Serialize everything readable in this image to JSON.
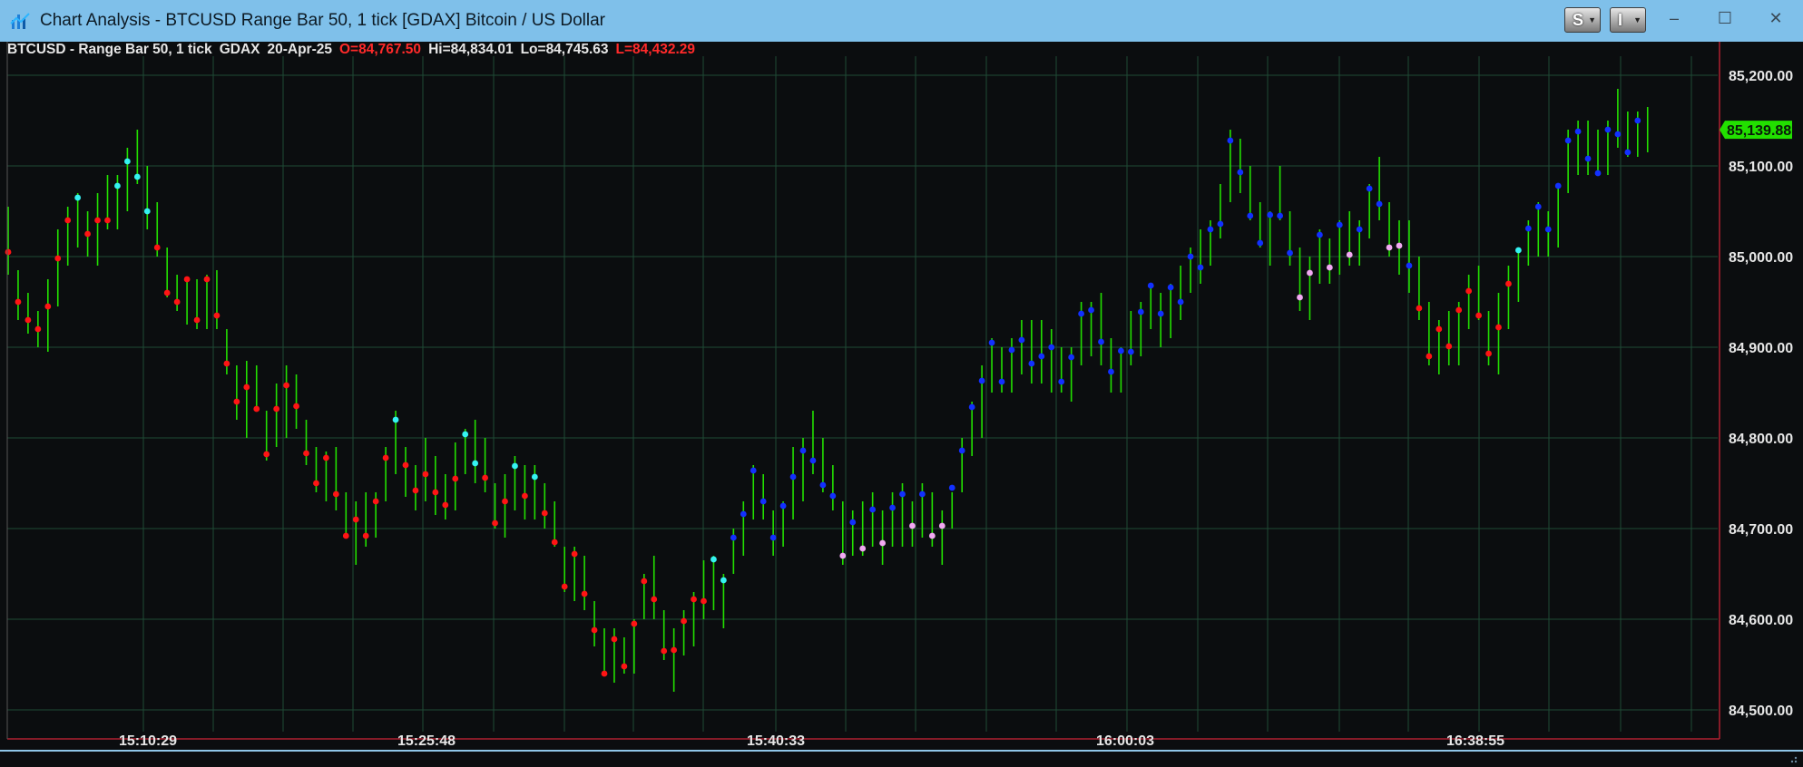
{
  "window": {
    "title": "Chart Analysis - BTCUSD Range Bar 50, 1 tick [GDAX] Bitcoin / US Dollar",
    "buttons": [
      {
        "label": "S"
      },
      {
        "label": "I"
      }
    ],
    "controls": {
      "minimize": "–",
      "maximize": "☐",
      "close": "✕"
    }
  },
  "header": {
    "symbol": "BTCUSD - Range Bar 50, 1 tick",
    "exchange": "GDAX",
    "date": "20-Apr-25",
    "open": "O=84,767.50",
    "high": "Hi=84,834.01",
    "low": "Lo=84,745.63",
    "last": "L=84,432.29"
  },
  "colors": {
    "background": "#0b0d0f",
    "grid": "#1f4a36",
    "bar": "#22e000",
    "axis_separator": "#b02030",
    "last_price_badge": "#22e000",
    "dot_red": "#ff1414",
    "dot_cyan": "#35f2f2",
    "dot_blue": "#1230ff",
    "dot_pink": "#f2a8f2"
  },
  "chart_data": {
    "type": "range-bar",
    "ylim": [
      84480,
      85240
    ],
    "y_ticks": [
      "85,200.00",
      "85,100.00",
      "85,000.00",
      "84,900.00",
      "84,800.00",
      "84,700.00",
      "84,600.00",
      "84,500.00"
    ],
    "x_ticks": [
      "15:10:29",
      "15:25:48",
      "15:40:33",
      "16:00:03",
      "16:38:55"
    ],
    "last_price": "85,139.88",
    "bars": [
      {
        "h": 85055,
        "l": 84980,
        "c": 85005,
        "dot": "red"
      },
      {
        "h": 84985,
        "l": 84930,
        "c": 84950,
        "dot": "red"
      },
      {
        "h": 84960,
        "l": 84915,
        "c": 84930,
        "dot": "red"
      },
      {
        "h": 84940,
        "l": 84900,
        "c": 84920,
        "dot": "red"
      },
      {
        "h": 84975,
        "l": 84895,
        "c": 84945,
        "dot": "red"
      },
      {
        "h": 85030,
        "l": 84945,
        "c": 84998,
        "dot": "red"
      },
      {
        "h": 85055,
        "l": 84990,
        "c": 85040,
        "dot": "red"
      },
      {
        "h": 85070,
        "l": 85010,
        "c": 85065,
        "dot": "cyan"
      },
      {
        "h": 85050,
        "l": 85000,
        "c": 85025,
        "dot": "red"
      },
      {
        "h": 85070,
        "l": 84990,
        "c": 85040,
        "dot": "red"
      },
      {
        "h": 85090,
        "l": 85030,
        "c": 85040,
        "dot": "red"
      },
      {
        "h": 85090,
        "l": 85030,
        "c": 85078,
        "dot": "cyan"
      },
      {
        "h": 85120,
        "l": 85050,
        "c": 85105,
        "dot": "cyan"
      },
      {
        "h": 85140,
        "l": 85080,
        "c": 85088,
        "dot": "cyan"
      },
      {
        "h": 85100,
        "l": 85030,
        "c": 85050,
        "dot": "cyan"
      },
      {
        "h": 85060,
        "l": 85000,
        "c": 85010,
        "dot": "red"
      },
      {
        "h": 85010,
        "l": 84955,
        "c": 84960,
        "dot": "red"
      },
      {
        "h": 84980,
        "l": 84940,
        "c": 84950,
        "dot": "red"
      },
      {
        "h": 84975,
        "l": 84925,
        "c": 84975,
        "dot": "red"
      },
      {
        "h": 84975,
        "l": 84920,
        "c": 84930,
        "dot": "red"
      },
      {
        "h": 84980,
        "l": 84920,
        "c": 84975,
        "dot": "red"
      },
      {
        "h": 84985,
        "l": 84920,
        "c": 84935,
        "dot": "red"
      },
      {
        "h": 84920,
        "l": 84870,
        "c": 84882,
        "dot": "red"
      },
      {
        "h": 84880,
        "l": 84820,
        "c": 84840,
        "dot": "red"
      },
      {
        "h": 84885,
        "l": 84800,
        "c": 84856,
        "dot": "red"
      },
      {
        "h": 84880,
        "l": 84830,
        "c": 84832,
        "dot": "red"
      },
      {
        "h": 84830,
        "l": 84775,
        "c": 84782,
        "dot": "red"
      },
      {
        "h": 84860,
        "l": 84790,
        "c": 84832,
        "dot": "red"
      },
      {
        "h": 84880,
        "l": 84800,
        "c": 84858,
        "dot": "red"
      },
      {
        "h": 84870,
        "l": 84810,
        "c": 84835,
        "dot": "red"
      },
      {
        "h": 84820,
        "l": 84770,
        "c": 84783,
        "dot": "red"
      },
      {
        "h": 84790,
        "l": 84740,
        "c": 84750,
        "dot": "red"
      },
      {
        "h": 84785,
        "l": 84730,
        "c": 84778,
        "dot": "red"
      },
      {
        "h": 84790,
        "l": 84720,
        "c": 84738,
        "dot": "red"
      },
      {
        "h": 84740,
        "l": 84690,
        "c": 84692,
        "dot": "red"
      },
      {
        "h": 84730,
        "l": 84660,
        "c": 84710,
        "dot": "red"
      },
      {
        "h": 84740,
        "l": 84680,
        "c": 84692,
        "dot": "red"
      },
      {
        "h": 84740,
        "l": 84690,
        "c": 84730,
        "dot": "red"
      },
      {
        "h": 84790,
        "l": 84730,
        "c": 84778,
        "dot": "red"
      },
      {
        "h": 84830,
        "l": 84760,
        "c": 84820,
        "dot": "cyan"
      },
      {
        "h": 84790,
        "l": 84735,
        "c": 84770,
        "dot": "red"
      },
      {
        "h": 84770,
        "l": 84720,
        "c": 84742,
        "dot": "red"
      },
      {
        "h": 84800,
        "l": 84730,
        "c": 84760,
        "dot": "red"
      },
      {
        "h": 84780,
        "l": 84715,
        "c": 84740,
        "dot": "red"
      },
      {
        "h": 84760,
        "l": 84710,
        "c": 84726,
        "dot": "red"
      },
      {
        "h": 84795,
        "l": 84720,
        "c": 84755,
        "dot": "red"
      },
      {
        "h": 84810,
        "l": 84760,
        "c": 84804,
        "dot": "cyan"
      },
      {
        "h": 84820,
        "l": 84750,
        "c": 84772,
        "dot": "cyan"
      },
      {
        "h": 84800,
        "l": 84740,
        "c": 84756,
        "dot": "red"
      },
      {
        "h": 84750,
        "l": 84700,
        "c": 84706,
        "dot": "red"
      },
      {
        "h": 84760,
        "l": 84690,
        "c": 84730,
        "dot": "red"
      },
      {
        "h": 84780,
        "l": 84720,
        "c": 84769,
        "dot": "cyan"
      },
      {
        "h": 84770,
        "l": 84710,
        "c": 84736,
        "dot": "red"
      },
      {
        "h": 84770,
        "l": 84710,
        "c": 84757,
        "dot": "cyan"
      },
      {
        "h": 84750,
        "l": 84700,
        "c": 84717,
        "dot": "red"
      },
      {
        "h": 84730,
        "l": 84680,
        "c": 84685,
        "dot": "red"
      },
      {
        "h": 84680,
        "l": 84630,
        "c": 84636,
        "dot": "red"
      },
      {
        "h": 84680,
        "l": 84620,
        "c": 84672,
        "dot": "red"
      },
      {
        "h": 84670,
        "l": 84610,
        "c": 84628,
        "dot": "red"
      },
      {
        "h": 84620,
        "l": 84570,
        "c": 84588,
        "dot": "red"
      },
      {
        "h": 84590,
        "l": 84540,
        "c": 84540,
        "dot": "red"
      },
      {
        "h": 84590,
        "l": 84530,
        "c": 84578,
        "dot": "red"
      },
      {
        "h": 84580,
        "l": 84540,
        "c": 84548,
        "dot": "red"
      },
      {
        "h": 84600,
        "l": 84540,
        "c": 84595,
        "dot": "red"
      },
      {
        "h": 84650,
        "l": 84600,
        "c": 84642,
        "dot": "red"
      },
      {
        "h": 84670,
        "l": 84600,
        "c": 84622,
        "dot": "red"
      },
      {
        "h": 84610,
        "l": 84555,
        "c": 84565,
        "dot": "red"
      },
      {
        "h": 84590,
        "l": 84520,
        "c": 84566,
        "dot": "red"
      },
      {
        "h": 84610,
        "l": 84560,
        "c": 84598,
        "dot": "red"
      },
      {
        "h": 84630,
        "l": 84570,
        "c": 84622,
        "dot": "red"
      },
      {
        "h": 84665,
        "l": 84600,
        "c": 84620,
        "dot": "red"
      },
      {
        "h": 84670,
        "l": 84610,
        "c": 84666,
        "dot": "cyan"
      },
      {
        "h": 84650,
        "l": 84590,
        "c": 84643,
        "dot": "cyan"
      },
      {
        "h": 84700,
        "l": 84650,
        "c": 84690,
        "dot": "blue"
      },
      {
        "h": 84730,
        "l": 84670,
        "c": 84716,
        "dot": "blue"
      },
      {
        "h": 84770,
        "l": 84710,
        "c": 84764,
        "dot": "blue"
      },
      {
        "h": 84760,
        "l": 84710,
        "c": 84730,
        "dot": "blue"
      },
      {
        "h": 84720,
        "l": 84670,
        "c": 84690,
        "dot": "blue"
      },
      {
        "h": 84730,
        "l": 84680,
        "c": 84725,
        "dot": "blue"
      },
      {
        "h": 84790,
        "l": 84710,
        "c": 84757,
        "dot": "blue"
      },
      {
        "h": 84800,
        "l": 84730,
        "c": 84786,
        "dot": "blue"
      },
      {
        "h": 84830,
        "l": 84760,
        "c": 84775,
        "dot": "blue"
      },
      {
        "h": 84800,
        "l": 84740,
        "c": 84748,
        "dot": "blue"
      },
      {
        "h": 84770,
        "l": 84720,
        "c": 84736,
        "dot": "blue"
      },
      {
        "h": 84730,
        "l": 84660,
        "c": 84670,
        "dot": "pink"
      },
      {
        "h": 84720,
        "l": 84670,
        "c": 84707,
        "dot": "blue"
      },
      {
        "h": 84730,
        "l": 84670,
        "c": 84678,
        "dot": "pink"
      },
      {
        "h": 84740,
        "l": 84680,
        "c": 84721,
        "dot": "blue"
      },
      {
        "h": 84720,
        "l": 84660,
        "c": 84684,
        "dot": "pink"
      },
      {
        "h": 84740,
        "l": 84680,
        "c": 84723,
        "dot": "blue"
      },
      {
        "h": 84750,
        "l": 84680,
        "c": 84738,
        "dot": "blue"
      },
      {
        "h": 84730,
        "l": 84680,
        "c": 84703,
        "dot": "pink"
      },
      {
        "h": 84750,
        "l": 84690,
        "c": 84738,
        "dot": "blue"
      },
      {
        "h": 84740,
        "l": 84680,
        "c": 84692,
        "dot": "pink"
      },
      {
        "h": 84720,
        "l": 84660,
        "c": 84703,
        "dot": "pink"
      },
      {
        "h": 84740,
        "l": 84700,
        "c": 84745,
        "dot": "blue"
      },
      {
        "h": 84800,
        "l": 84740,
        "c": 84786,
        "dot": "blue"
      },
      {
        "h": 84840,
        "l": 84780,
        "c": 84834,
        "dot": "blue"
      },
      {
        "h": 84880,
        "l": 84800,
        "c": 84863,
        "dot": "blue"
      },
      {
        "h": 84910,
        "l": 84850,
        "c": 84905,
        "dot": "blue"
      },
      {
        "h": 84900,
        "l": 84850,
        "c": 84862,
        "dot": "blue"
      },
      {
        "h": 84910,
        "l": 84850,
        "c": 84897,
        "dot": "blue"
      },
      {
        "h": 84930,
        "l": 84870,
        "c": 84908,
        "dot": "blue"
      },
      {
        "h": 84930,
        "l": 84860,
        "c": 84882,
        "dot": "blue"
      },
      {
        "h": 84930,
        "l": 84860,
        "c": 84890,
        "dot": "blue"
      },
      {
        "h": 84920,
        "l": 84850,
        "c": 84900,
        "dot": "blue"
      },
      {
        "h": 84900,
        "l": 84850,
        "c": 84862,
        "dot": "blue"
      },
      {
        "h": 84900,
        "l": 84840,
        "c": 84889,
        "dot": "blue"
      },
      {
        "h": 84950,
        "l": 84880,
        "c": 84937,
        "dot": "blue"
      },
      {
        "h": 84950,
        "l": 84890,
        "c": 84941,
        "dot": "blue"
      },
      {
        "h": 84960,
        "l": 84880,
        "c": 84906,
        "dot": "blue"
      },
      {
        "h": 84910,
        "l": 84850,
        "c": 84873,
        "dot": "blue"
      },
      {
        "h": 84900,
        "l": 84850,
        "c": 84896,
        "dot": "blue"
      },
      {
        "h": 84940,
        "l": 84880,
        "c": 84895,
        "dot": "blue"
      },
      {
        "h": 84950,
        "l": 84890,
        "c": 84939,
        "dot": "blue"
      },
      {
        "h": 84970,
        "l": 84920,
        "c": 84968,
        "dot": "blue"
      },
      {
        "h": 84960,
        "l": 84900,
        "c": 84937,
        "dot": "blue"
      },
      {
        "h": 84970,
        "l": 84910,
        "c": 84966,
        "dot": "blue"
      },
      {
        "h": 84990,
        "l": 84930,
        "c": 84950,
        "dot": "blue"
      },
      {
        "h": 85010,
        "l": 84960,
        "c": 85000,
        "dot": "blue"
      },
      {
        "h": 85030,
        "l": 84970,
        "c": 84988,
        "dot": "blue"
      },
      {
        "h": 85040,
        "l": 84990,
        "c": 85030,
        "dot": "blue"
      },
      {
        "h": 85080,
        "l": 85020,
        "c": 85036,
        "dot": "blue"
      },
      {
        "h": 85140,
        "l": 85060,
        "c": 85128,
        "dot": "blue"
      },
      {
        "h": 85130,
        "l": 85070,
        "c": 85093,
        "dot": "blue"
      },
      {
        "h": 85100,
        "l": 85040,
        "c": 85045,
        "dot": "blue"
      },
      {
        "h": 85060,
        "l": 85010,
        "c": 85015,
        "dot": "blue"
      },
      {
        "h": 85050,
        "l": 84990,
        "c": 85046,
        "dot": "blue"
      },
      {
        "h": 85100,
        "l": 85040,
        "c": 85045,
        "dot": "blue"
      },
      {
        "h": 85050,
        "l": 84990,
        "c": 85004,
        "dot": "blue"
      },
      {
        "h": 85010,
        "l": 84940,
        "c": 84955,
        "dot": "pink"
      },
      {
        "h": 85000,
        "l": 84930,
        "c": 84982,
        "dot": "pink"
      },
      {
        "h": 85030,
        "l": 84970,
        "c": 85024,
        "dot": "blue"
      },
      {
        "h": 85020,
        "l": 84970,
        "c": 84988,
        "dot": "pink"
      },
      {
        "h": 85040,
        "l": 84980,
        "c": 85035,
        "dot": "blue"
      },
      {
        "h": 85050,
        "l": 84990,
        "c": 85002,
        "dot": "pink"
      },
      {
        "h": 85040,
        "l": 84990,
        "c": 85030,
        "dot": "blue"
      },
      {
        "h": 85080,
        "l": 85020,
        "c": 85075,
        "dot": "blue"
      },
      {
        "h": 85110,
        "l": 85040,
        "c": 85058,
        "dot": "blue"
      },
      {
        "h": 85060,
        "l": 85000,
        "c": 85010,
        "dot": "pink"
      },
      {
        "h": 85040,
        "l": 84980,
        "c": 85012,
        "dot": "pink"
      },
      {
        "h": 85040,
        "l": 84960,
        "c": 84990,
        "dot": "blue"
      },
      {
        "h": 85000,
        "l": 84930,
        "c": 84943,
        "dot": "red"
      },
      {
        "h": 84950,
        "l": 84880,
        "c": 84890,
        "dot": "red"
      },
      {
        "h": 84930,
        "l": 84870,
        "c": 84920,
        "dot": "red"
      },
      {
        "h": 84940,
        "l": 84880,
        "c": 84901,
        "dot": "red"
      },
      {
        "h": 84950,
        "l": 84880,
        "c": 84941,
        "dot": "red"
      },
      {
        "h": 84980,
        "l": 84920,
        "c": 84962,
        "dot": "red"
      },
      {
        "h": 84990,
        "l": 84930,
        "c": 84935,
        "dot": "red"
      },
      {
        "h": 84940,
        "l": 84880,
        "c": 84893,
        "dot": "red"
      },
      {
        "h": 84960,
        "l": 84870,
        "c": 84922,
        "dot": "red"
      },
      {
        "h": 84990,
        "l": 84920,
        "c": 84970,
        "dot": "red"
      },
      {
        "h": 85010,
        "l": 84950,
        "c": 85007,
        "dot": "cyan"
      },
      {
        "h": 85040,
        "l": 84990,
        "c": 85031,
        "dot": "blue"
      },
      {
        "h": 85060,
        "l": 85000,
        "c": 85055,
        "dot": "blue"
      },
      {
        "h": 85050,
        "l": 85000,
        "c": 85030,
        "dot": "blue"
      },
      {
        "h": 85080,
        "l": 85010,
        "c": 85078,
        "dot": "blue"
      },
      {
        "h": 85140,
        "l": 85070,
        "c": 85128,
        "dot": "blue"
      },
      {
        "h": 85150,
        "l": 85090,
        "c": 85138,
        "dot": "blue"
      },
      {
        "h": 85150,
        "l": 85090,
        "c": 85108,
        "dot": "blue"
      },
      {
        "h": 85140,
        "l": 85090,
        "c": 85092,
        "dot": "blue"
      },
      {
        "h": 85150,
        "l": 85090,
        "c": 85140,
        "dot": "blue"
      },
      {
        "h": 85185,
        "l": 85120,
        "c": 85135,
        "dot": "blue"
      },
      {
        "h": 85160,
        "l": 85110,
        "c": 85115,
        "dot": "blue"
      },
      {
        "h": 85160,
        "l": 85110,
        "c": 85150,
        "dot": "blue"
      },
      {
        "h": 85165,
        "l": 85115,
        "c": 85140,
        "dot": "none"
      }
    ]
  }
}
